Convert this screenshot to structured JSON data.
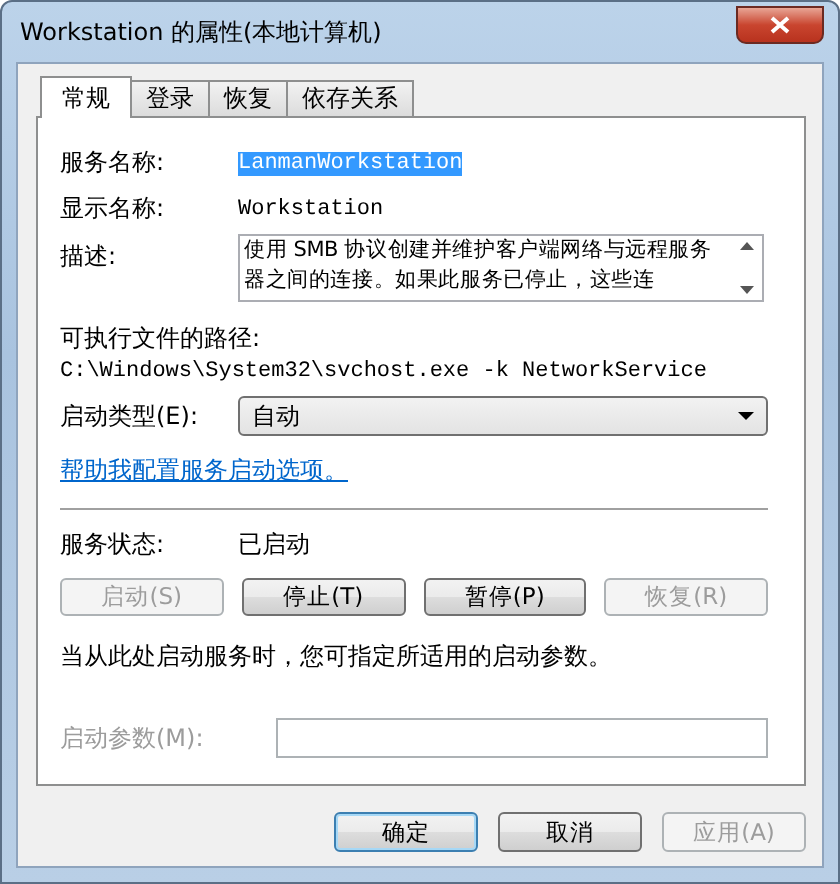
{
  "window": {
    "title": "Workstation 的属性(本地计算机)"
  },
  "tabs": [
    {
      "label": "常规",
      "selected": true
    },
    {
      "label": "登录",
      "selected": false
    },
    {
      "label": "恢复",
      "selected": false
    },
    {
      "label": "依存关系",
      "selected": false
    }
  ],
  "general": {
    "service_name": {
      "label": "服务名称:",
      "value": "LanmanWorkstation",
      "selected": true
    },
    "display_name": {
      "label": "显示名称:",
      "value": "Workstation"
    },
    "description": {
      "label": "描述:",
      "value": "使用 SMB 协议创建并维护客户端网络与远程服务器之间的连接。如果此服务已停止，这些连"
    },
    "path": {
      "label": "可执行文件的路径:",
      "value": "C:\\Windows\\System32\\svchost.exe -k NetworkService"
    },
    "startup_type": {
      "label": "启动类型(E):",
      "value": "自动"
    },
    "help_link": "帮助我配置服务启动选项。",
    "status": {
      "label": "服务状态:",
      "value": "已启动"
    },
    "service_buttons": [
      {
        "label": "启动(S)",
        "disabled": true
      },
      {
        "label": "停止(T)",
        "disabled": false
      },
      {
        "label": "暂停(P)",
        "disabled": false
      },
      {
        "label": "恢复(R)",
        "disabled": true
      }
    ],
    "note": "当从此处启动服务时，您可指定所适用的启动参数。",
    "start_params": {
      "label": "启动参数(M):",
      "disabled": true
    }
  },
  "buttons": [
    {
      "label": "确定",
      "disabled": false,
      "default": true
    },
    {
      "label": "取消",
      "disabled": false,
      "default": false
    },
    {
      "label": "应用(A)",
      "disabled": true,
      "default": false
    }
  ]
}
